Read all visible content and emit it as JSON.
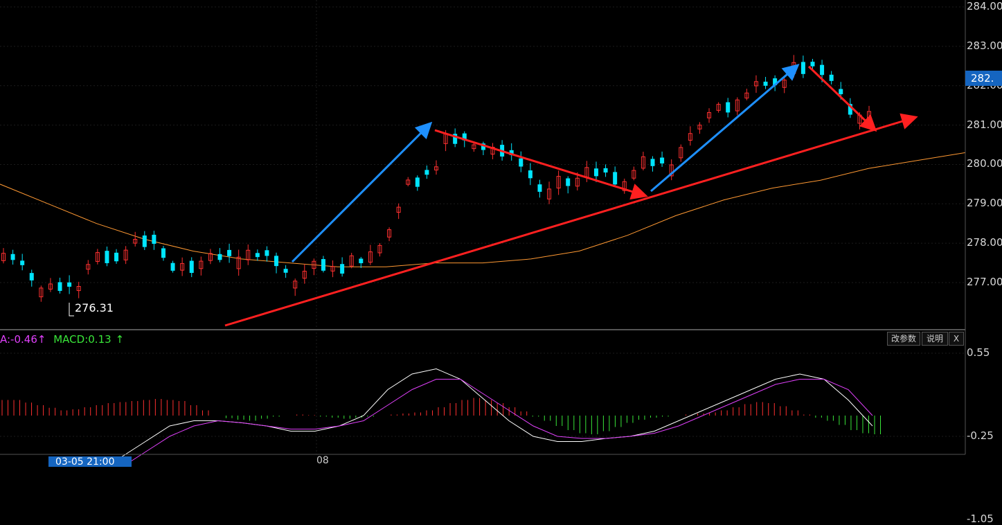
{
  "price_axis": [
    "284.00",
    "283.00",
    "282.00",
    "281.00",
    "280.00",
    "279.00",
    "278.00",
    "277.00"
  ],
  "current_price": "282.",
  "low_marker": "276.31",
  "macd_panel": {
    "dea_text": "A:-0.46",
    "dea_arrow": "↑",
    "macd_text": "MACD:0.13",
    "macd_arrow": "↑",
    "buttons": {
      "params": "改参数",
      "help": "说明",
      "close": "X"
    },
    "axis": [
      "0.55",
      "-0.25",
      "-1.05"
    ]
  },
  "time_axis": {
    "cursor_label": "03-05 21:00",
    "date_label": "08"
  },
  "colors": {
    "up": "#ff3030",
    "down": "#00e5ff",
    "ma": "#ff9933",
    "trend_red": "#ff2020",
    "trend_blue": "#1e90ff",
    "dif": "#ffffff",
    "dea": "#e040fb",
    "hist_pos": "#ff3030",
    "hist_neg": "#39e639"
  },
  "chart_data": [
    {
      "type": "candlestick",
      "ylim": [
        276.0,
        284.2
      ],
      "x": [
        "",
        "",
        "",
        "",
        "",
        "",
        "",
        "",
        "",
        "",
        "",
        "",
        "",
        "",
        "",
        "",
        "",
        "",
        "",
        "",
        "",
        "",
        "",
        "",
        "",
        "",
        "",
        "",
        "",
        "",
        "",
        "",
        "",
        "",
        "",
        "",
        "",
        "",
        "",
        "",
        "",
        "",
        "",
        "",
        "",
        "",
        "",
        "",
        "",
        "",
        "",
        "",
        "",
        "",
        "",
        "",
        "",
        "",
        "",
        "",
        "",
        "",
        "",
        "",
        "",
        "",
        "",
        "",
        "",
        "",
        "",
        "",
        "",
        "",
        "",
        "",
        "",
        "",
        "",
        "",
        "",
        "",
        "",
        "",
        "",
        "",
        "",
        "",
        "",
        "",
        "",
        "",
        "",
        "",
        "",
        "",
        "",
        "",
        "",
        "",
        "",
        "",
        "",
        "",
        "",
        "",
        "",
        "",
        "",
        "",
        "",
        "",
        "",
        "",
        "",
        "",
        "",
        "",
        "",
        "",
        "",
        "",
        "",
        "",
        "",
        "",
        "",
        "",
        "",
        "",
        "",
        "",
        "",
        "",
        "",
        "",
        "",
        "",
        "",
        "",
        "",
        "",
        "",
        "",
        "",
        "",
        "",
        "",
        "",
        "",
        "",
        "",
        "",
        "",
        "",
        "",
        "",
        "",
        "",
        "",
        "",
        "",
        "",
        "",
        "",
        "",
        "",
        "",
        "",
        "",
        "",
        "",
        "",
        "",
        "",
        "",
        "",
        "",
        "",
        "",
        "",
        "",
        "",
        "",
        "",
        "",
        "",
        "",
        "",
        "",
        "",
        "",
        "",
        "",
        "",
        "",
        "",
        "",
        "",
        "",
        "",
        "",
        "",
        "",
        "",
        ""
      ],
      "anchors_y": [
        277.6,
        277.7,
        277.3,
        277.0,
        276.7,
        276.8,
        277.0,
        276.9,
        276.5,
        277.2,
        277.6,
        277.7,
        277.6,
        277.5,
        277.9,
        278.2,
        278.0,
        277.5,
        277.3,
        277.2,
        277.6,
        277.4,
        277.5,
        277.8,
        277.7,
        277.4,
        277.6,
        277.8,
        277.7,
        277.4,
        277.2,
        276.9,
        277.0,
        277.4,
        277.5,
        277.2,
        277.5,
        277.4,
        277.7,
        277.6,
        277.7,
        278.0,
        278.5,
        279.2,
        279.9,
        279.7,
        279.3,
        280.5,
        280.8,
        280.6,
        280.4,
        280.5,
        280.3,
        280.4,
        280.2,
        279.9,
        279.6,
        279.2,
        279.0,
        279.5,
        279.6,
        279.4,
        279.7,
        279.9,
        279.8,
        279.5,
        279.3,
        279.6,
        279.9,
        280.2,
        280.0,
        279.7,
        280.0,
        280.6,
        280.8,
        281.1,
        281.4,
        281.5,
        281.4,
        281.6,
        281.9,
        282.2,
        282.0,
        281.8,
        282.3,
        282.6,
        282.5,
        282.3,
        282.1,
        281.6,
        281.2,
        281.1,
        281.2
      ],
      "low": 276.31,
      "ma_line_y": [
        279.5,
        279.0,
        278.5,
        278.1,
        277.8,
        277.6,
        277.5,
        277.4,
        277.4,
        277.5,
        277.5,
        277.6,
        277.8,
        278.2,
        278.7,
        279.1,
        279.4,
        279.6,
        279.9,
        280.1,
        280.3
      ],
      "trendlines": "drawn"
    },
    {
      "type": "bar",
      "series": [
        {
          "values": [
            0.3,
            0.3,
            0.25,
            0.2,
            0.15,
            0.1,
            0.12,
            0.16,
            0.2,
            0.24,
            0.26,
            0.28,
            0.3,
            0.32,
            0.3,
            0.28,
            0.2,
            0.1,
            0.0,
            -0.05,
            -0.08,
            -0.1,
            -0.06,
            -0.02,
            0.0,
            0.02,
            0.01,
            -0.02,
            -0.04,
            -0.06,
            -0.04,
            -0.02,
            0.0,
            0.02,
            0.04,
            0.06,
            0.1,
            0.16,
            0.24,
            0.3,
            0.34,
            0.3,
            0.24,
            0.16,
            0.08,
            -0.02,
            -0.1,
            -0.2,
            -0.28,
            -0.34,
            -0.36,
            -0.3,
            -0.22,
            -0.14,
            -0.08,
            -0.04,
            -0.02,
            0.0,
            0.02,
            0.04,
            0.06,
            0.1,
            0.16,
            0.22,
            0.26,
            0.24,
            0.18,
            0.1,
            0.02,
            -0.04,
            -0.1,
            -0.18,
            -0.28,
            -0.34,
            -0.36
          ]
        }
      ],
      "ylim": [
        -1.3,
        0.75
      ]
    }
  ]
}
